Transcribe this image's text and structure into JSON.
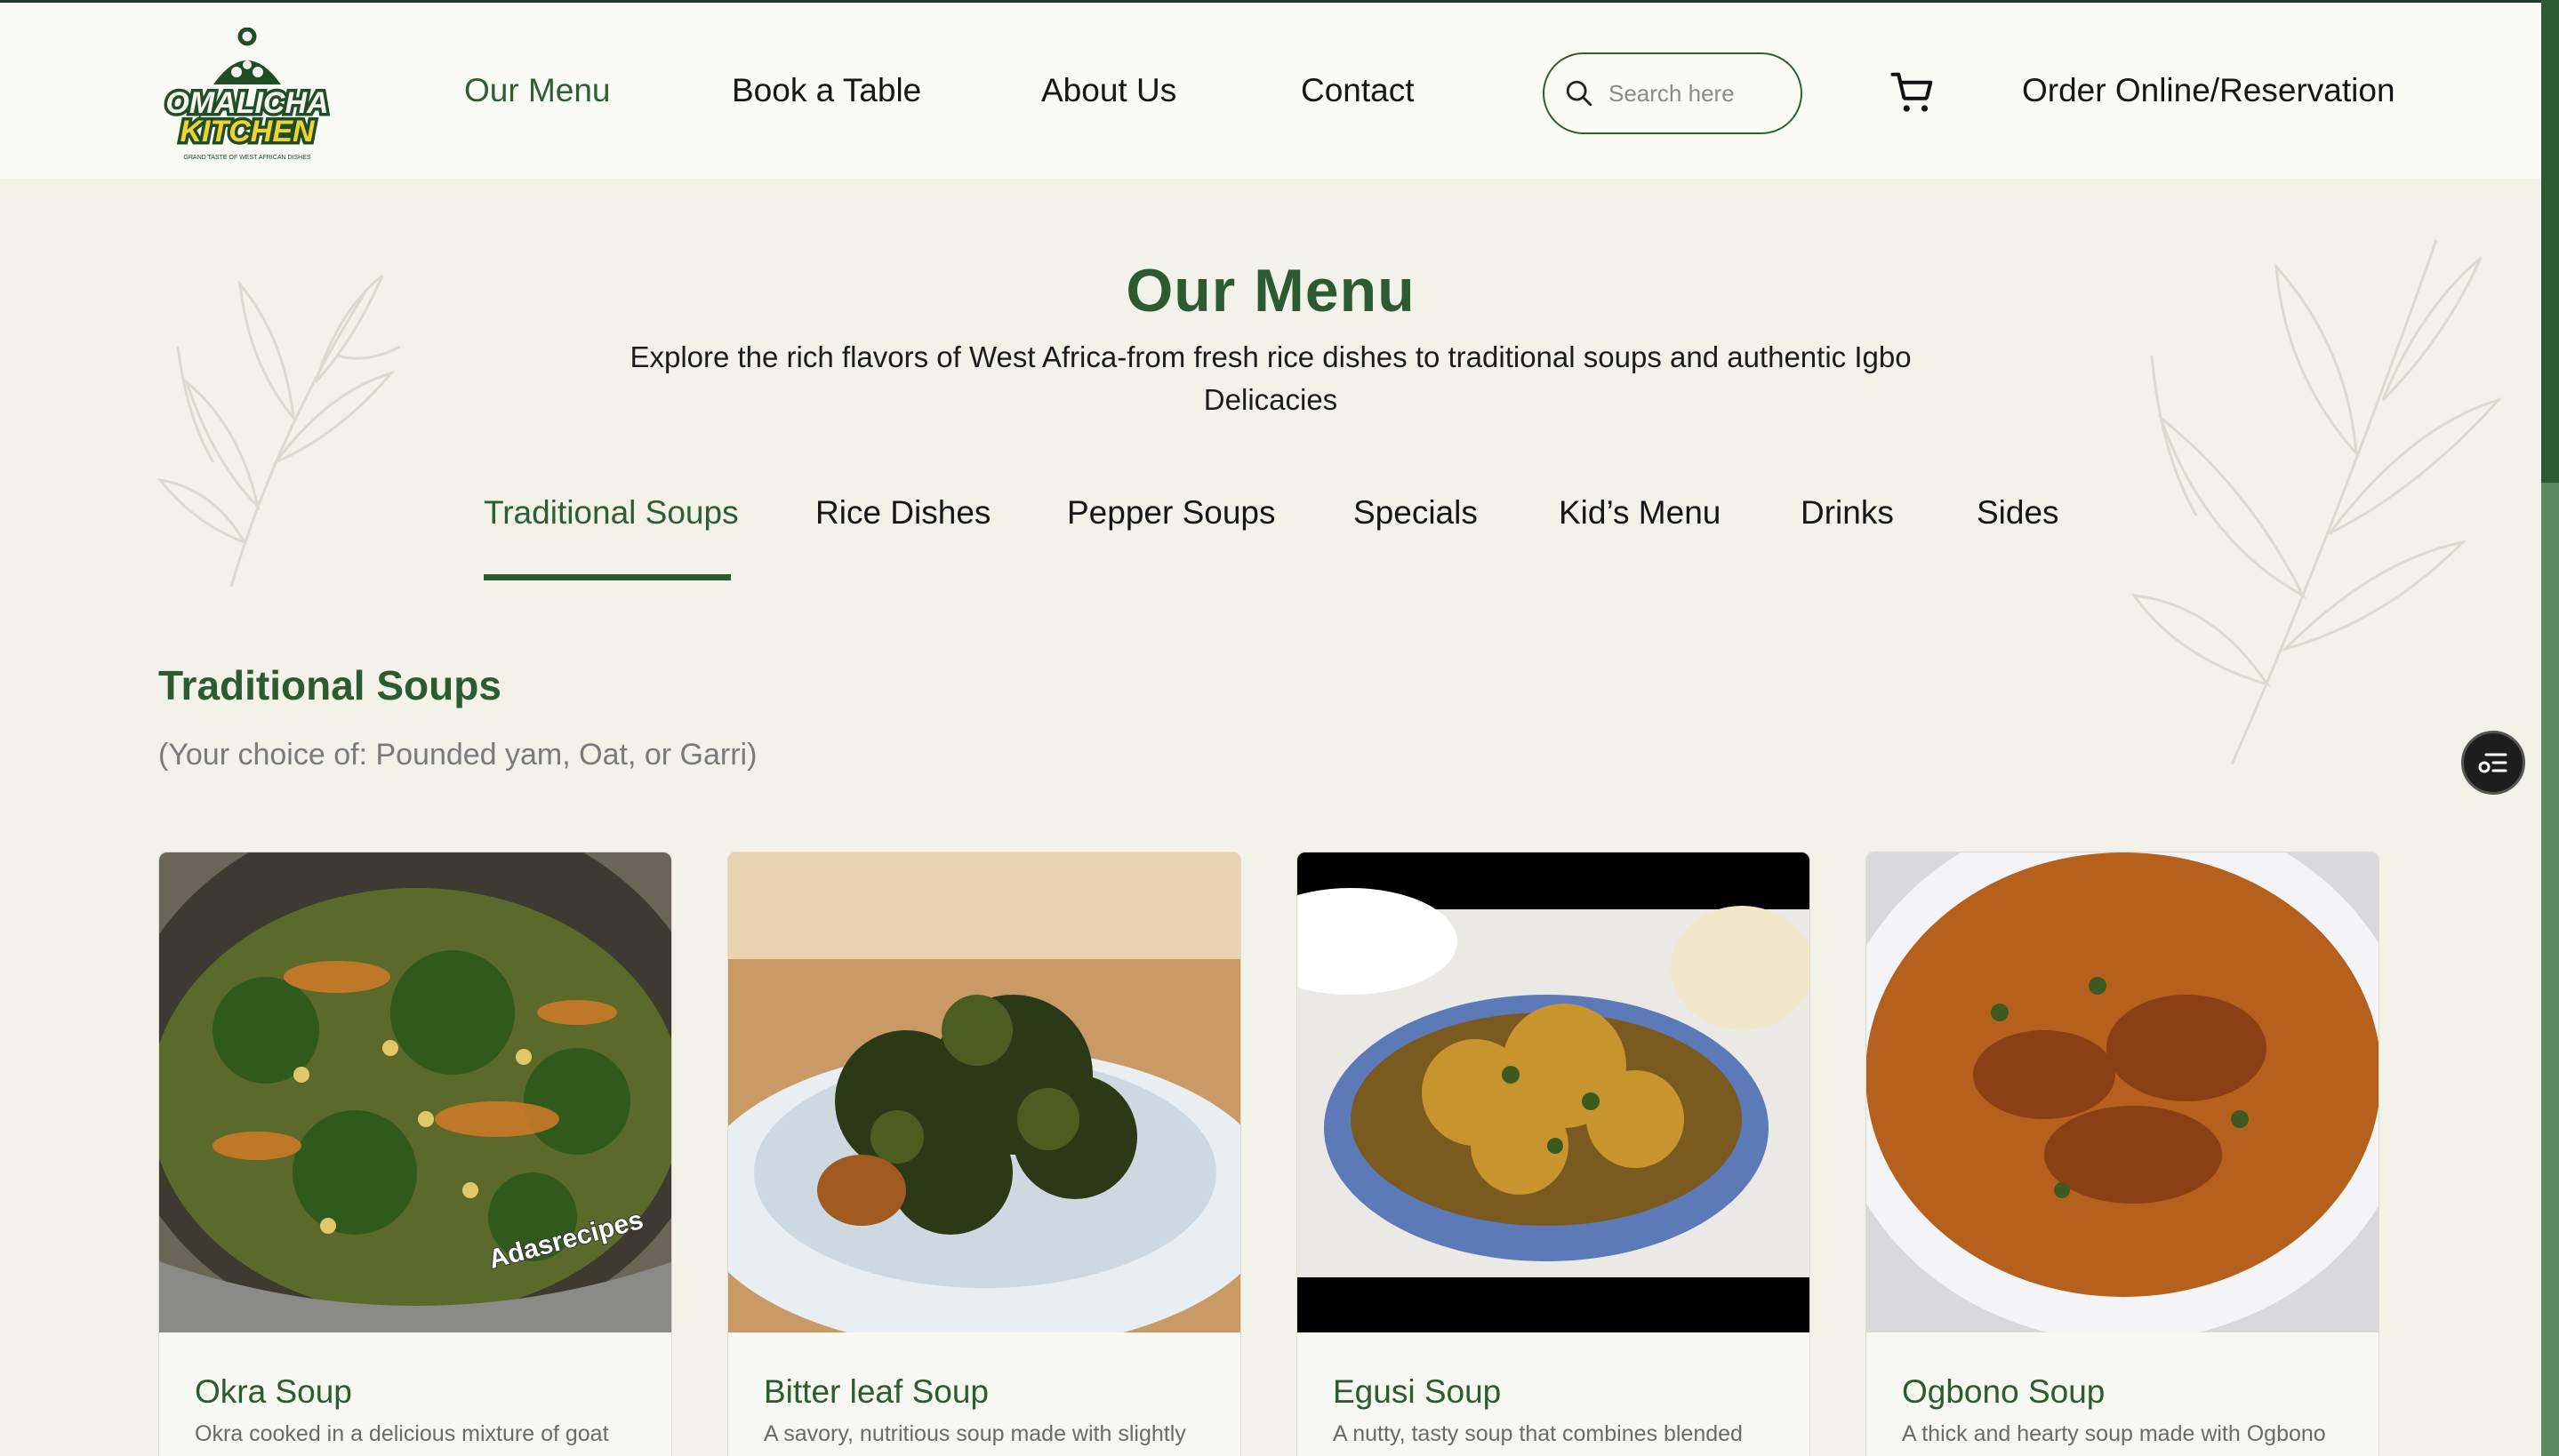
{
  "header": {
    "logo": {
      "line1": "OMALICHA",
      "line2": "KITCHEN",
      "tagline": "GRAND TASTE OF WEST AFRICAN DISHES"
    },
    "nav": [
      {
        "label": "Our Menu",
        "active": true
      },
      {
        "label": "Book a Table",
        "active": false
      },
      {
        "label": "About Us",
        "active": false
      },
      {
        "label": "Contact",
        "active": false
      }
    ],
    "search": {
      "placeholder": "Search here",
      "icon": "search-icon"
    },
    "cart_icon": "cart-icon",
    "cta_label": "Order Online/Reservation"
  },
  "hero": {
    "title": "Our Menu",
    "subtitle": "Explore the rich flavors of West Africa-from fresh rice dishes to traditional soups and authentic Igbo Delicacies"
  },
  "tabs": [
    {
      "label": "Traditional Soups",
      "active": true
    },
    {
      "label": "Rice Dishes",
      "active": false
    },
    {
      "label": "Pepper Soups",
      "active": false
    },
    {
      "label": "Specials",
      "active": false
    },
    {
      "label": "Kid’s Menu",
      "active": false
    },
    {
      "label": "Drinks",
      "active": false
    },
    {
      "label": "Sides",
      "active": false
    }
  ],
  "section": {
    "title": "Traditional Soups",
    "subtitle": "(Your choice of: Pounded yam, Oat, or Garri)"
  },
  "cards": [
    {
      "title": "Okra Soup",
      "desc": "Okra cooked in a delicious mixture of goat",
      "watermark": "Adasrecipes"
    },
    {
      "title": "Bitter leaf Soup",
      "desc": "A savory, nutritious soup made with slightly"
    },
    {
      "title": "Egusi Soup",
      "desc": "A nutty, tasty soup that combines blended"
    },
    {
      "title": "Ogbono Soup",
      "desc": "A thick and hearty soup made with Ogbono"
    }
  ],
  "colors": {
    "brand_green": "#2c5a31",
    "page_bg": "#f3f2e9",
    "header_bg": "#fbfbf6",
    "logo_yellow": "#f2d233"
  },
  "fab_icon": "list-settings-icon"
}
